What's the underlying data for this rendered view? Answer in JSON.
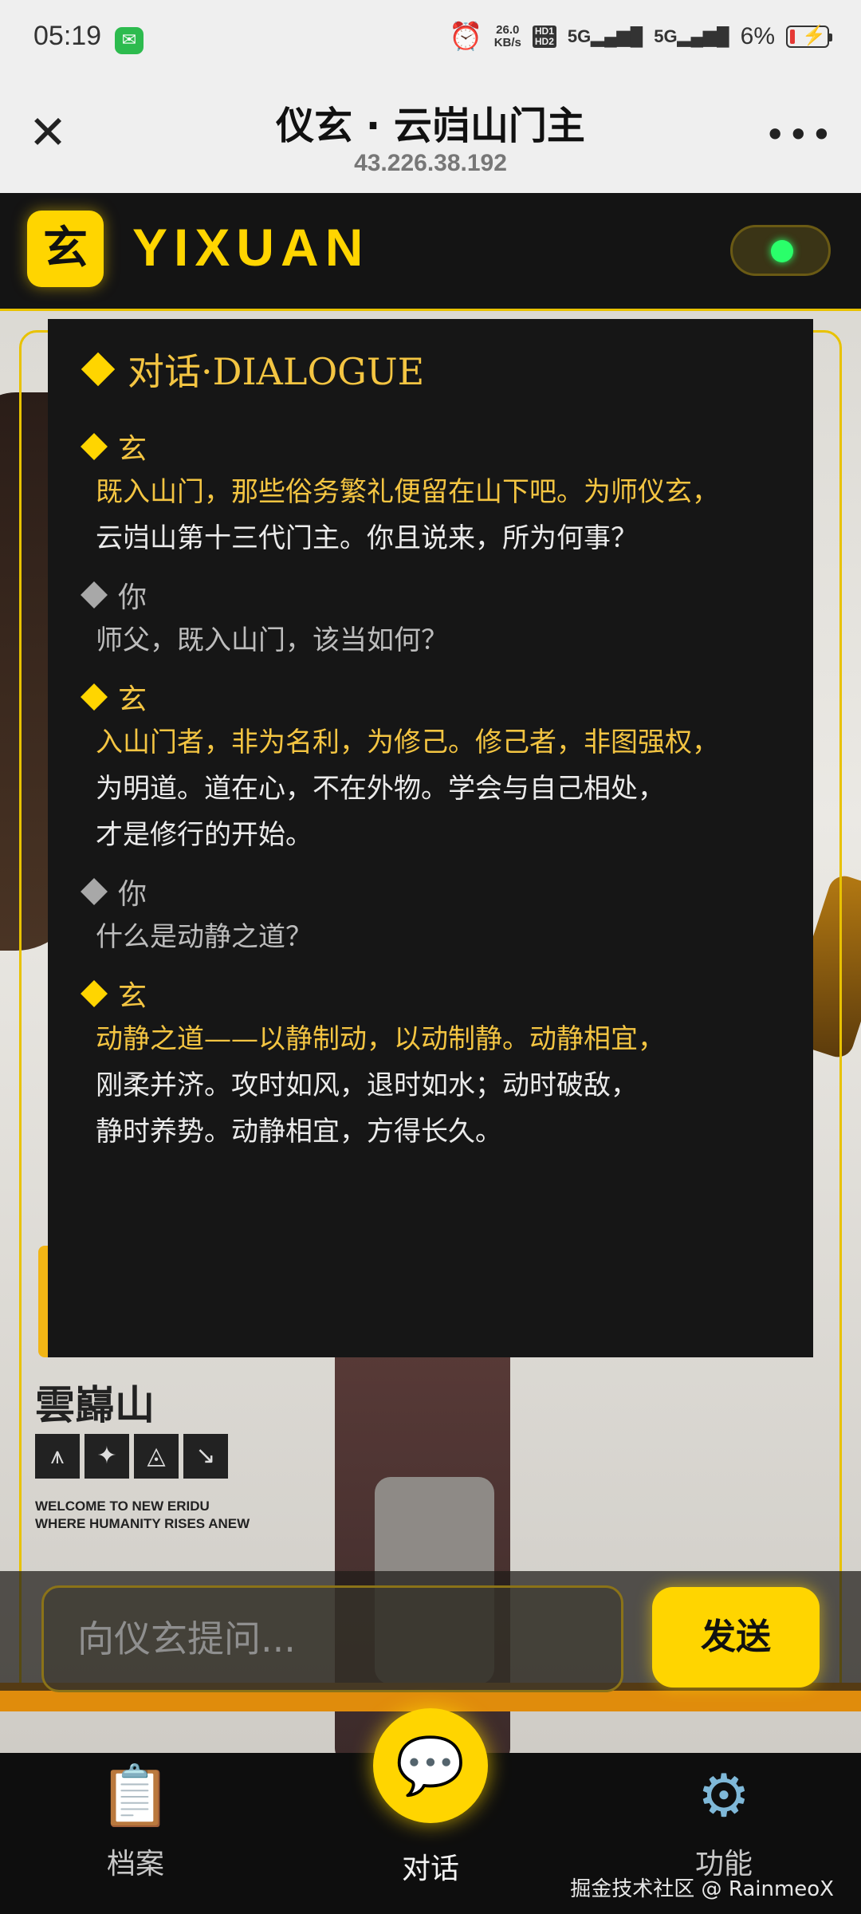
{
  "status_bar": {
    "time": "05:19",
    "speed_value": "26.0",
    "speed_unit": "KB/s",
    "hd1": "HD1",
    "hd2": "HD2",
    "sig1": "5G",
    "sig2": "5G",
    "battery": "6%",
    "battery_color": "#e53935"
  },
  "browser": {
    "title": "仪玄 · 云岿山门主",
    "url": "43.226.38.192",
    "close_glyph": "✕",
    "more_glyph": "•••"
  },
  "header": {
    "logo_char": "玄",
    "logo_text": "YIXUAN",
    "accent": "#ffd500",
    "online_color": "#2aff6a"
  },
  "poster": {
    "title_cn": "雲巋山",
    "welcome_1": "WELCOME TO NEW ERIDU",
    "welcome_2": "WHERE HUMANITY RISES ANEW"
  },
  "dialogue": {
    "title": "对话·DIALOGUE",
    "messages": [
      {
        "speaker": "玄",
        "highlight": "既入山门，那些俗务繁礼便留在山下吧。为师仪玄，",
        "rest": "云岿山第十三代门主。你且说来，所为何事？"
      },
      {
        "speaker": "你",
        "text": "师父，既入山门，该当如何？"
      },
      {
        "speaker": "玄",
        "highlight": "入山门者，非为名利，为修己。修己者，非图强权，",
        "rest_1": "为明道。道在心，不在外物。学会与自己相处，",
        "rest_2": "才是修行的开始。"
      },
      {
        "speaker": "你",
        "text": "什么是动静之道？"
      },
      {
        "speaker": "玄",
        "highlight": "动静之道——以静制动，以动制静。动静相宜，",
        "rest_1": "刚柔并济。攻时如风，退时如水；动时破敌，",
        "rest_2": "静时养势。动静相宜，方得长久。"
      }
    ]
  },
  "input": {
    "placeholder": "向仪玄提问...",
    "send_label": "发送"
  },
  "nav": {
    "archive_label": "档案",
    "chat_label": "对话",
    "func_label": "功能"
  },
  "watermark": "掘金技术社区 @ RainmeoX"
}
